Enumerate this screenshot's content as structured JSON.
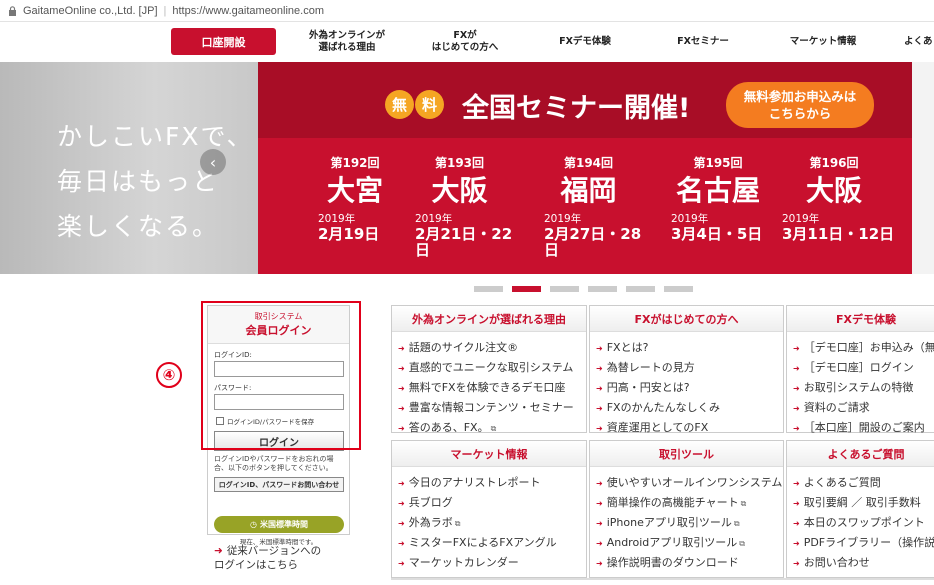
{
  "address_bar": {
    "site": "GaitameOnline co.,Ltd. [JP]",
    "url": "https://www.gaitameonline.com"
  },
  "nav": {
    "open_account": "口座開設",
    "items": [
      "外為オンラインが\n選ばれる理由",
      "FXが\nはじめての方へ",
      "FXデモ体験",
      "FXセミナー",
      "マーケット情報",
      "よくあ"
    ]
  },
  "hero": {
    "tagline": "かしこいFXで、\n毎日はもっと\n楽しくなる。",
    "prev": "‹",
    "free": [
      "無",
      "料"
    ],
    "headline": "全国セミナー開催!",
    "cta": "無料参加お申込みは\nこちらから",
    "seminars": [
      {
        "no": "第192回",
        "city": "大宮",
        "year": "2019年",
        "date": "2月19日"
      },
      {
        "no": "第193回",
        "city": "大阪",
        "year": "2019年",
        "date": "2月21日・22日"
      },
      {
        "no": "第194回",
        "city": "福岡",
        "year": "2019年",
        "date": "2月27日・28日"
      },
      {
        "no": "第195回",
        "city": "名古屋",
        "year": "2019年",
        "date": "3月4日・5日"
      },
      {
        "no": "第196回",
        "city": "大阪",
        "year": "2019年",
        "date": "3月11日・12日"
      }
    ]
  },
  "login": {
    "system_label": "取引システム",
    "title": "会員ログイン",
    "id_label": "ログインID:",
    "pw_label": "パスワード:",
    "save_label": "ログインID/パスワードを保存",
    "login_button": "ログイン",
    "forgot_note": "ログインIDやパスワードをお忘れの場合、以下のボタンを押してください。",
    "inquiry_button": "ログインID、パスワードお問い合わせ",
    "clock_label": "米国標準時間",
    "now_label": "現在、米国標準時間です。"
  },
  "annotation_number": "④",
  "old_version_link": "従来バージョンへの\nログインはこちら",
  "panels": [
    {
      "title": "外為オンラインが選ばれる理由",
      "items": [
        "話題のサイクル注文®",
        "直感的でユニークな取引システム",
        "無料でFXを体験できるデモ口座",
        "豊富な情報コンテンツ・セミナー",
        "答のある、FX。"
      ]
    },
    {
      "title": "FXがはじめての方へ",
      "items": [
        "FXとは?",
        "為替レートの見方",
        "円高・円安とは?",
        "FXのかんたんなしくみ",
        "資産運用としてのFX"
      ]
    },
    {
      "title": "FXデモ体験",
      "items": [
        "［デモ口座］お申込み（無",
        "［デモ口座］ログイン",
        "お取引システムの特徴",
        "資料のご請求",
        "［本口座］開設のご案内"
      ]
    },
    {
      "title": "マーケット情報",
      "items": [
        "今日のアナリストレポート",
        "兵ブログ",
        "外為ラボ",
        "ミスターFXによるFXアングル",
        "マーケットカレンダー"
      ]
    },
    {
      "title": "取引ツール",
      "items": [
        "使いやすいオールインワンシステム",
        "簡単操作の高機能チャート",
        "iPhoneアプリ取引ツール",
        "Androidアプリ取引ツール",
        "操作説明書のダウンロード"
      ]
    },
    {
      "title": "よくあるご質問",
      "items": [
        "よくあるご質問",
        "取引要綱 ／ 取引手数料",
        "本日のスワップポイント",
        "PDFライブラリー（操作説",
        "お問い合わせ"
      ]
    }
  ],
  "colors": {
    "brand_red": "#c8102e",
    "cta_orange": "#f47c20",
    "clock_green": "#98a326"
  }
}
